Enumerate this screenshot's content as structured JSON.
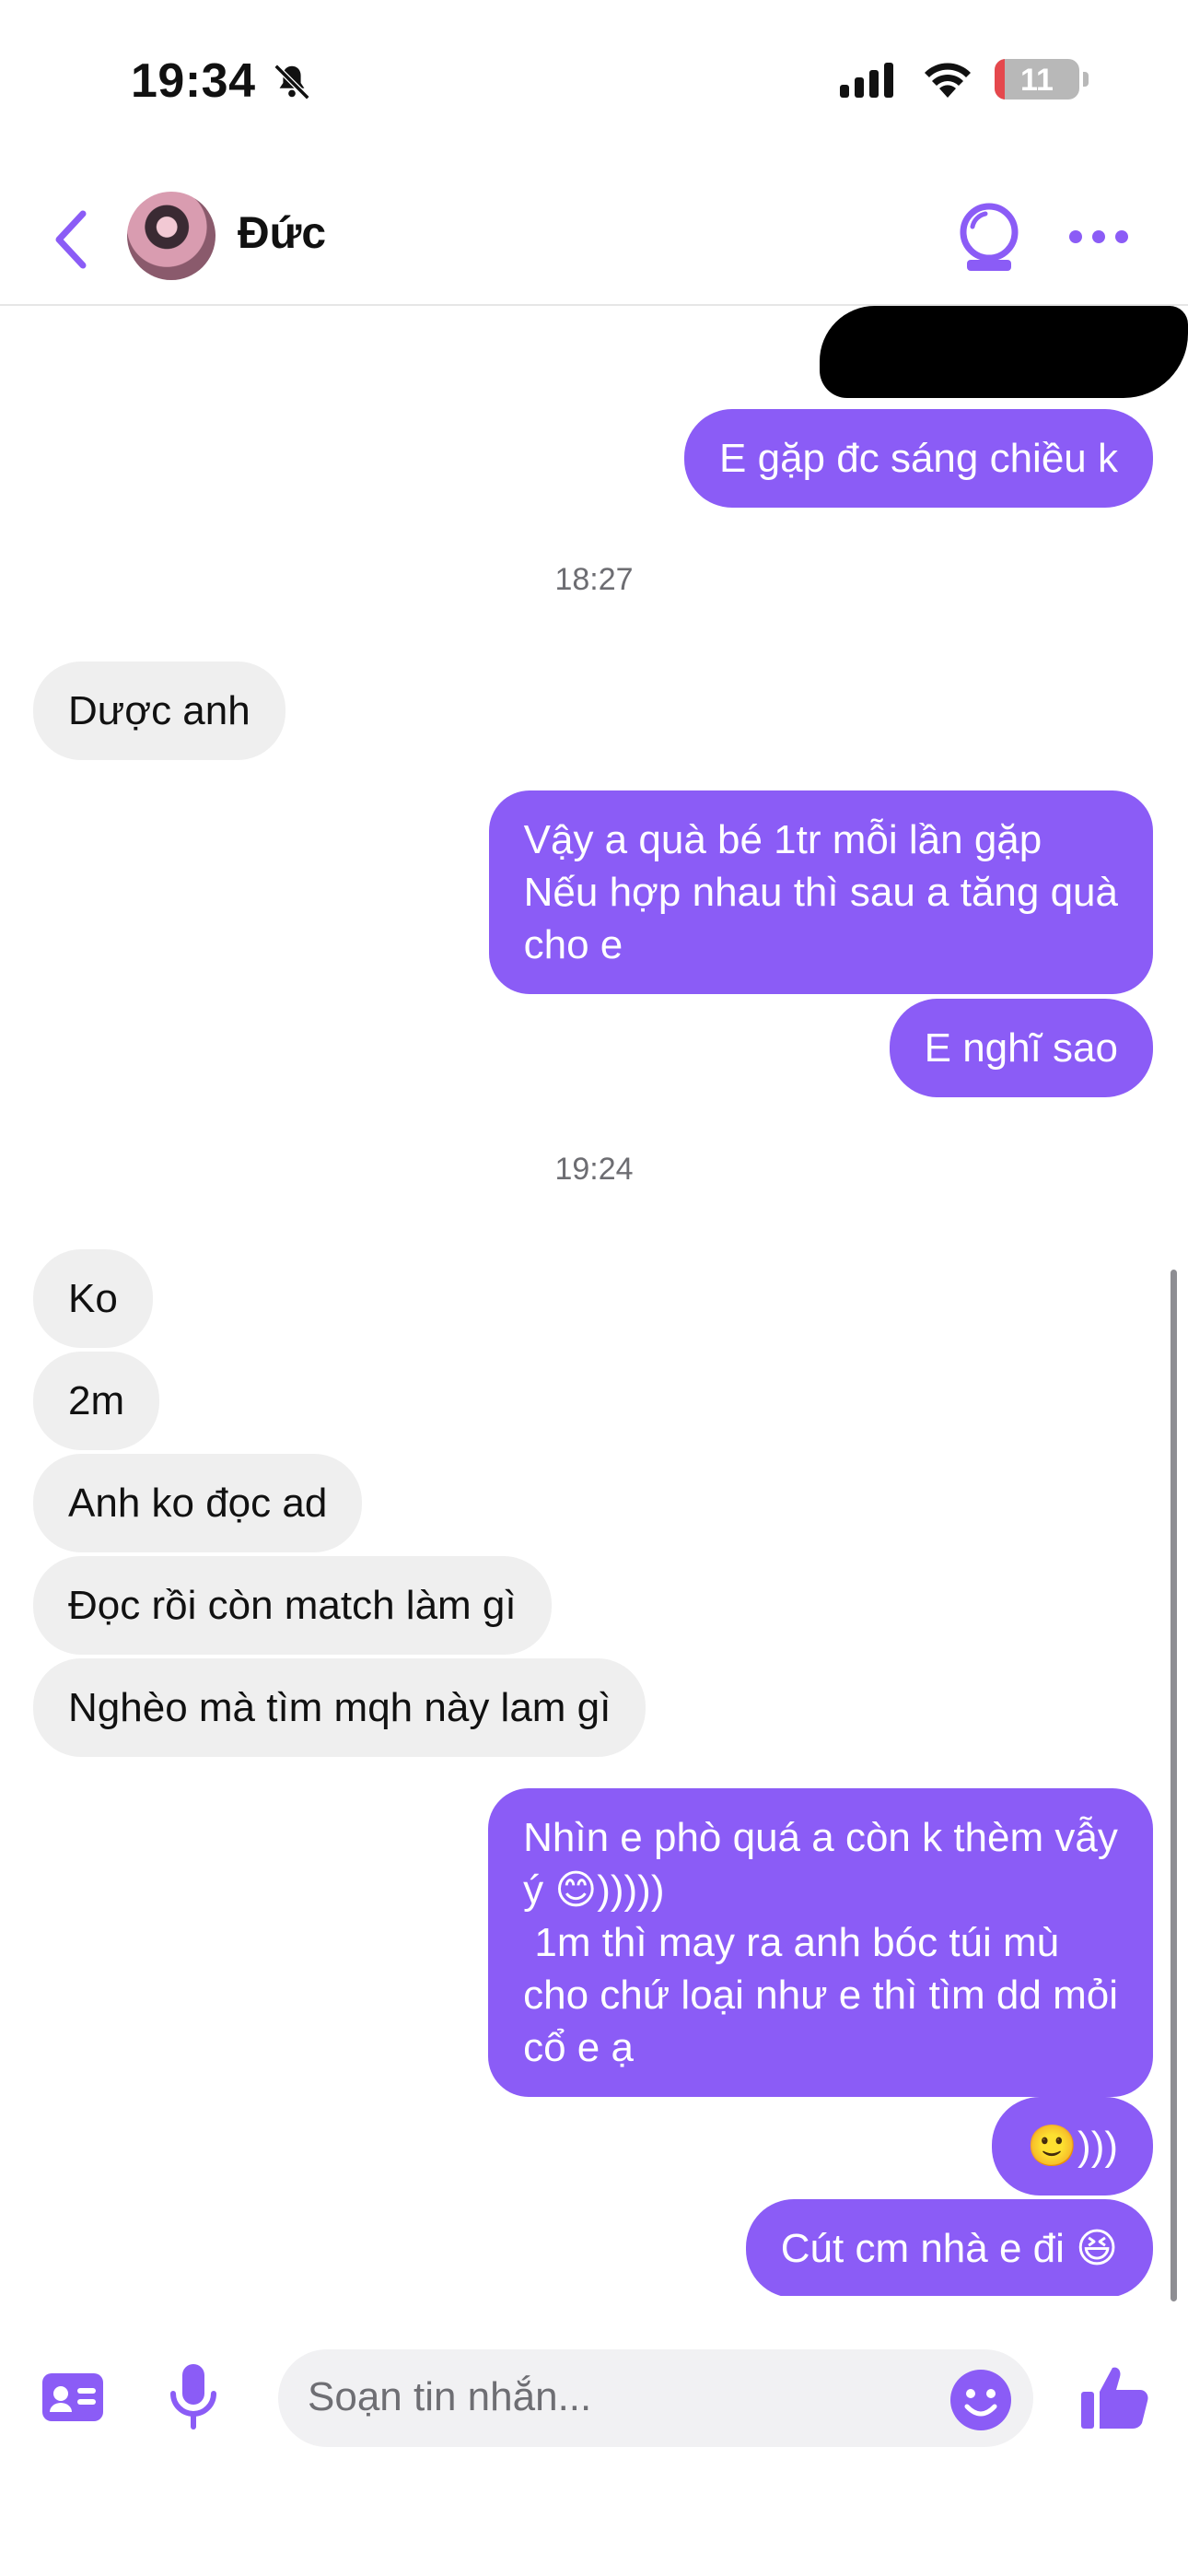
{
  "status_bar": {
    "time": "19:34",
    "battery": "11"
  },
  "header": {
    "contact_name": "Đức"
  },
  "messages": {
    "m0": "E gặp đc sáng chiều k",
    "t1": "18:27",
    "m1": "Dược anh",
    "m2": "Vậy a quà bé 1tr mỗi lần gặp\nNếu hợp nhau thì sau a tăng quà\ncho e",
    "m3": "E nghĩ sao",
    "t2": "19:24",
    "m4": "Ko",
    "m5": "2m",
    "m6": "Anh ko đọc ad",
    "m7": "Đọc rồi còn match làm gì",
    "m8": "Nghèo mà tìm mqh này lam gì",
    "m9": "Nhìn e phò quá a còn k thèm vẫy\ný 😊)))))\n 1m thì may ra anh bóc túi mù\ncho chứ loại như e thì tìm dd mỏi\ncổ e ạ",
    "m10": "🙂)))",
    "m11": "Cút cm nhà e đi 😆"
  },
  "composer": {
    "placeholder": "Soạn tin nhắn..."
  },
  "colors": {
    "accent": "#8b5cf6",
    "incoming_bubble": "#efefef"
  },
  "icons": [
    "bell-off-icon",
    "signal-icon",
    "wifi-icon",
    "battery-icon",
    "back-chevron-icon",
    "crystal-ball-icon",
    "more-dots-icon",
    "contact-card-icon",
    "microphone-icon",
    "smiley-icon",
    "thumbs-up-icon"
  ]
}
